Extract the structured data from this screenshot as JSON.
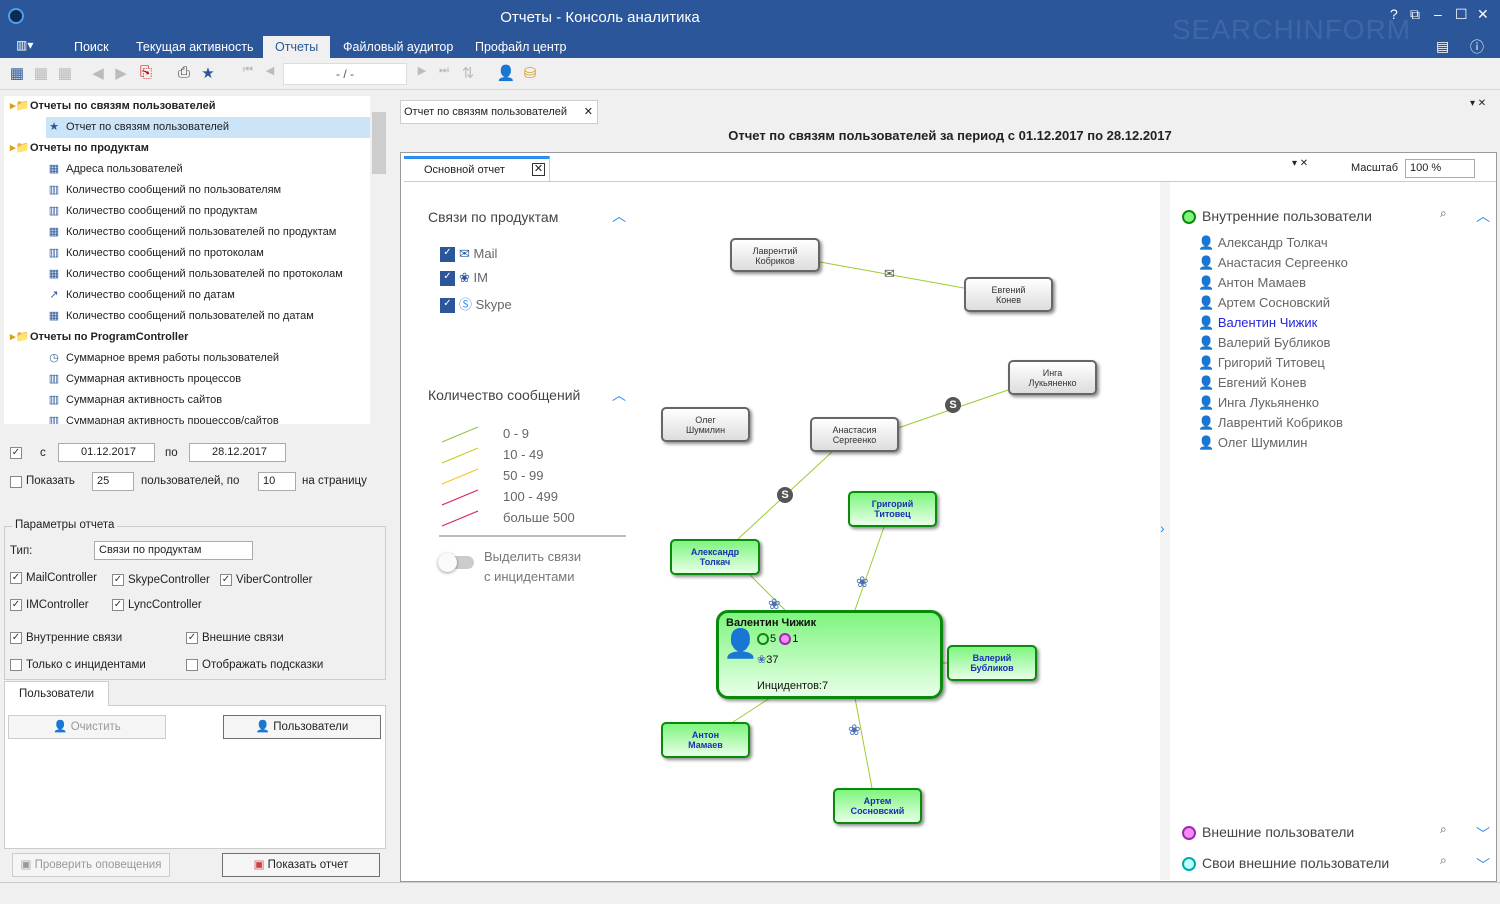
{
  "window": {
    "title": "Отчеты - Консоль аналитика",
    "brand": "SEARCHINFORM"
  },
  "menu": {
    "tabs": [
      "Поиск",
      "Текущая активность",
      "Отчеты",
      "Файловый аудитор",
      "Профайл центр"
    ],
    "active": "Отчеты"
  },
  "toolbar": {
    "page_indicator": "- / -"
  },
  "tree": {
    "groups": [
      {
        "label": "Отчеты по связям пользователей",
        "items": [
          "Отчет по связям пользователей"
        ]
      },
      {
        "label": "Отчеты по продуктам",
        "items": [
          "Адреса пользователей",
          "Количество сообщений по пользователям",
          "Количество сообщений по продуктам",
          "Количество сообщений пользователей по продуктам",
          "Количество сообщений по протоколам",
          "Количество сообщений пользователей по протоколам",
          "Количество сообщений по датам",
          "Количество сообщений пользователей по датам"
        ]
      },
      {
        "label": "Отчеты по ProgramController",
        "items": [
          "Суммарное время работы пользователей",
          "Суммарная активность процессов",
          "Суммарная активность сайтов",
          "Суммарная активность процессов/сайтов"
        ]
      }
    ],
    "selected": "Отчет по связям пользователей"
  },
  "period": {
    "from_label": "с",
    "from": "01.12.2017",
    "to_label": "по",
    "to": "28.12.2017"
  },
  "paging": {
    "show_label": "Показать",
    "users": "25",
    "users_label": "пользователей, по",
    "per_page": "10",
    "per_page_label": "на страницу"
  },
  "params": {
    "title": "Параметры отчета",
    "type_label": "Тип:",
    "type": "Связи по продуктам",
    "controllers": [
      {
        "label": "MailController",
        "checked": true
      },
      {
        "label": "SkypeController",
        "checked": true
      },
      {
        "label": "ViberController",
        "checked": true
      },
      {
        "label": "IMController",
        "checked": true
      },
      {
        "label": "LyncController",
        "checked": true
      }
    ],
    "internal": "Внутренние связи",
    "external": "Внешние связи",
    "incidents_only": "Только с инцидентами",
    "show_hints": "Отображать подсказки"
  },
  "users_tab": {
    "label": "Пользователи",
    "clear": "Очистить",
    "users_button": "Пользователи"
  },
  "footer": {
    "check_alerts": "Проверить оповещения",
    "show_report": "Показать отчет"
  },
  "report": {
    "tab": "Отчет по связям пользователей",
    "title": "Отчет по связям пользователей за период с 01.12.2017 по 28.12.2017",
    "inner_tab": "Основной отчет",
    "scale_label": "Масштаб",
    "scale": "100 %"
  },
  "filters": {
    "products_title": "Связи по продуктам",
    "products": [
      "Mail",
      "IM",
      "Skype"
    ],
    "count_title": "Количество сообщений",
    "ranges": [
      {
        "label": "0 - 9",
        "color": "#8dc63f"
      },
      {
        "label": "10 - 49",
        "color": "#c8c81e"
      },
      {
        "label": "50 - 99",
        "color": "#f5c518"
      },
      {
        "label": "100 - 499",
        "color": "#d81b60"
      },
      {
        "label": "больше 500",
        "color": "#d81b60"
      }
    ],
    "highlight": [
      "Выделить связи",
      "с инцидентами"
    ],
    "highlight_on": false
  },
  "graph": {
    "nodes": {
      "kobrikov": "Лаврентий\nКобриков",
      "konev": "Евгений\nКонев",
      "lukyanenko": "Инга\nЛукьяненко",
      "shumilin": "Олег\nШумилин",
      "sergeenko": "Анастасия\nСергеенко",
      "titovets": "Григорий\nТитовец",
      "tolkach": "Александр\nТолкач",
      "bublikov": "Валерий\nБубликов",
      "mamaev": "Антон\nМамаев",
      "sosnovsky": "Артем\nСосновский"
    },
    "focus": {
      "name": "Валентин Чижик",
      "internal": "5",
      "external": "1",
      "im": "37",
      "incidents": "Инцидентов:7"
    }
  },
  "users": {
    "internal_title": "Внутренние пользователи",
    "internal": [
      "Александр Толкач",
      "Анастасия Сергеенко",
      "Антон Мамаев",
      "Артем Сосновский",
      "Валентин Чижик",
      "Валерий Бубликов",
      "Григорий Титовец",
      "Евгений Конев",
      "Инга Лукьяненко",
      "Лаврентий Кобриков",
      "Олег Шумилин"
    ],
    "highlighted": "Валентин Чижик",
    "external_title": "Внешние пользователи",
    "own_external_title": "Свои внешние пользователи"
  },
  "colors": {
    "titlebar": "#2b579a",
    "node_green": "#7ef57e",
    "accent": "#2b8ef0"
  }
}
